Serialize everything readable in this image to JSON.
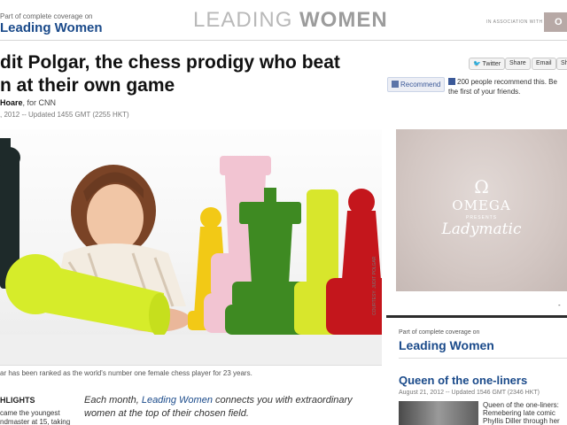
{
  "banner": {
    "part_of": "Part of complete coverage on",
    "series": "Leading Women",
    "title_light": "LEADING ",
    "title_bold": "WOMEN",
    "association": "IN ASSOCIATION WITH",
    "sponsor_tab": "O"
  },
  "article": {
    "headline_line1": "dit Polgar, the chess prodigy who beat",
    "headline_line2": "n at their own game",
    "author": "Hoare",
    "author_suffix": ", for CNN",
    "dateline": ", 2012 -- Updated 1455 GMT (2255 HKT)",
    "photo_credit": "COURTESY: JUDIT POLGAR",
    "caption": "ar has been ranked as the world's number one female chess player for 23 years.",
    "highlights_label": "HLIGHTS",
    "highlights_text": "came the youngest ndmaster at 15, taking",
    "intro_before": "Each month, ",
    "intro_link": "Leading Women",
    "intro_after": " connects you with extraordinary women at the top of their chosen field."
  },
  "share": {
    "twitter": "Twitter",
    "share": "Share",
    "email": "Email",
    "more": "Sh",
    "recommend": "Recommend",
    "fb_text": "200 people recommend this. Be the first of your friends."
  },
  "ad": {
    "symbol": "Ω",
    "brand": "OMEGA",
    "presents": "PRESENTS",
    "product": "Ladymatic"
  },
  "sidebar": {
    "part_of": "Part of complete coverage on",
    "series": "Leading Women",
    "story_title": "Queen of the one-liners",
    "story_date": "August 21, 2012 -- Updated 1546 GMT (2346 HKT)",
    "story_desc": "Queen of the one-liners: Remebering late comic Phyllis Diller through her funniest",
    "scroll_marker": "-"
  }
}
